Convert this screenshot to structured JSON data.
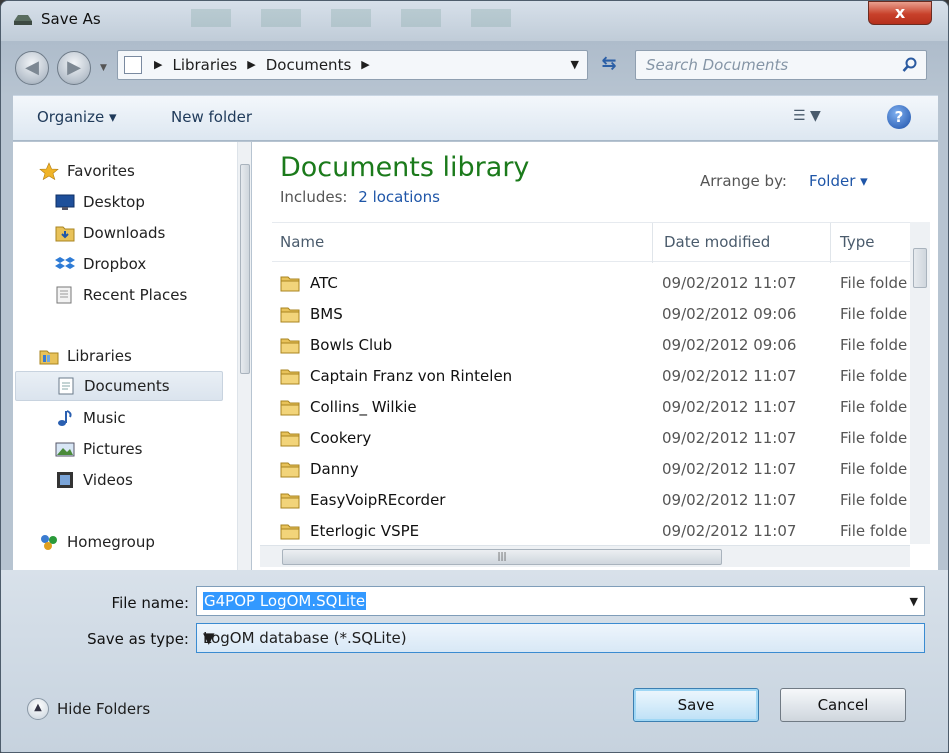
{
  "window": {
    "title": "Save As",
    "close_label": "x"
  },
  "nav": {
    "back_icon": "back-arrow-icon",
    "forward_icon": "forward-arrow-icon",
    "breadcrumb": [
      "Libraries",
      "Documents"
    ],
    "search_placeholder": "Search Documents"
  },
  "toolbar": {
    "organize_label": "Organize ▾",
    "new_folder_label": "New folder",
    "help_label": "?"
  },
  "sidebar": {
    "favorites": {
      "label": "Favorites",
      "items": [
        "Desktop",
        "Downloads",
        "Dropbox",
        "Recent Places"
      ]
    },
    "libraries": {
      "label": "Libraries",
      "items": [
        "Documents",
        "Music",
        "Pictures",
        "Videos"
      ],
      "selected": "Documents"
    },
    "homegroup": {
      "label": "Homegroup"
    }
  },
  "library": {
    "title": "Documents library",
    "includes_label": "Includes:",
    "includes_link": "2 locations",
    "arrange_label": "Arrange by:",
    "arrange_value": "Folder ▾"
  },
  "columns": {
    "name": "Name",
    "date": "Date modified",
    "type": "Type"
  },
  "files": [
    {
      "name": "ATC",
      "date": "09/02/2012 11:07",
      "type": "File folder"
    },
    {
      "name": "BMS",
      "date": "09/02/2012 09:06",
      "type": "File folder"
    },
    {
      "name": "Bowls Club",
      "date": "09/02/2012 09:06",
      "type": "File folder"
    },
    {
      "name": "Captain Franz von Rintelen",
      "date": "09/02/2012 11:07",
      "type": "File folder"
    },
    {
      "name": "Collins_ Wilkie",
      "date": "09/02/2012 11:07",
      "type": "File folder"
    },
    {
      "name": "Cookery",
      "date": "09/02/2012 11:07",
      "type": "File folder"
    },
    {
      "name": "Danny",
      "date": "09/02/2012 11:07",
      "type": "File folder"
    },
    {
      "name": "EasyVoipREcorder",
      "date": "09/02/2012 11:07",
      "type": "File folder"
    },
    {
      "name": "Eterlogic VSPE",
      "date": "09/02/2012 11:07",
      "type": "File folder"
    }
  ],
  "form": {
    "filename_label": "File name:",
    "filename_value": "G4POP LogOM.SQLite",
    "savetype_label": "Save as type:",
    "savetype_value": "LogOM database (*.SQLite)",
    "hide_folders_label": "Hide Folders",
    "save_label": "Save",
    "cancel_label": "Cancel"
  },
  "colors": {
    "library_title": "#1b7a1b",
    "link": "#1f56a8",
    "selection": "#3399ff"
  }
}
